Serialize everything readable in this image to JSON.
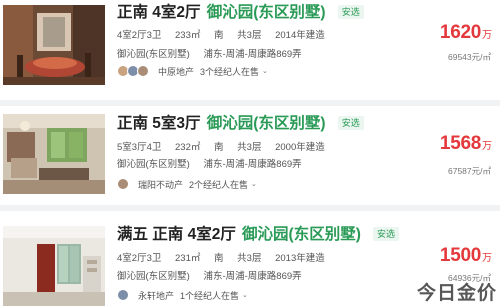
{
  "listings": [
    {
      "title_head": "正南 4室2厅",
      "community": "御沁园(东区别墅)",
      "tag": "安选",
      "specs": [
        "4室2厅3卫",
        "233㎡",
        "南",
        "共3层",
        "2014年建造"
      ],
      "address": [
        "御沁园(东区别墅)",
        "浦东-周浦-周康路869弄"
      ],
      "agency": "中原地产",
      "agent_count": "3个经纪人在售",
      "price": "1620",
      "price_unit": "万",
      "unit_price": "69543元/㎡"
    },
    {
      "title_head": "正南 5室3厅",
      "community": "御沁园(东区别墅)",
      "tag": "安选",
      "specs": [
        "5室3厅4卫",
        "232㎡",
        "南",
        "共3层",
        "2000年建造"
      ],
      "address": [
        "御沁园(东区别墅)",
        "浦东-周浦-周康路869弄"
      ],
      "agency": "瑞阳不动产",
      "agent_count": "2个经纪人在售",
      "price": "1568",
      "price_unit": "万",
      "unit_price": "67587元/㎡"
    },
    {
      "title_head": "满五 正南 4室2厅",
      "community": "御沁园(东区别墅)",
      "tag": "安选",
      "specs": [
        "4室2厅3卫",
        "231㎡",
        "南",
        "共3层",
        "2013年建造"
      ],
      "address": [
        "御沁园(东区别墅)",
        "浦东-周浦-周康路869弄"
      ],
      "agency": "永轩地产",
      "agent_count": "1个经纪人在售",
      "price": "1500",
      "price_unit": "万",
      "unit_price": "64936元/㎡"
    }
  ],
  "watermark": "今日金价",
  "colors": {
    "price": "#e4393c",
    "community": "#2a9a57",
    "tag_bg": "#eaf6ef"
  }
}
